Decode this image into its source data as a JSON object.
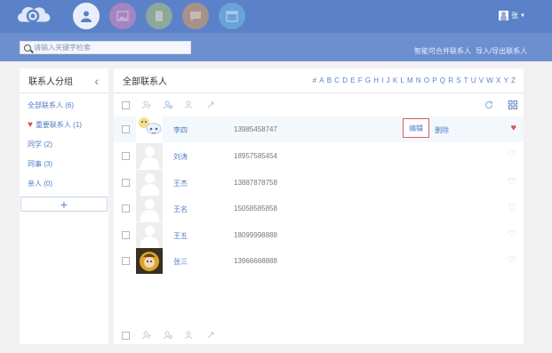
{
  "header": {
    "logo": "cloud-logo",
    "nav": [
      {
        "icon": "person-icon",
        "color": "#e9effa"
      },
      {
        "icon": "image-icon",
        "color": "#a385c2"
      },
      {
        "icon": "document-icon",
        "color": "#8da79a"
      },
      {
        "icon": "chat-icon",
        "color": "#a6928a"
      },
      {
        "icon": "calendar-icon",
        "color": "#6aa3d8"
      }
    ],
    "user_name": "张"
  },
  "search": {
    "placeholder": "请输入关键字检索"
  },
  "links": {
    "merge": "智能可合并联系人",
    "import_export": "导入/导出联系人"
  },
  "sidebar": {
    "title": "联系人分组",
    "groups": [
      {
        "label": "全部联系人 (6)"
      },
      {
        "label": "重要联系人 (1)",
        "icon": "heart-icon"
      },
      {
        "label": "同学 (2)"
      },
      {
        "label": "同事 (3)"
      },
      {
        "label": "亲人 (0)"
      }
    ],
    "add_label": "+"
  },
  "main": {
    "title": "全部联系人",
    "letters": [
      "#",
      "A",
      "B",
      "C",
      "D",
      "E",
      "F",
      "G",
      "H",
      "I",
      "J",
      "K",
      "L",
      "M",
      "N",
      "O",
      "P",
      "Q",
      "R",
      "S",
      "T",
      "U",
      "V",
      "W",
      "X",
      "Y",
      "Z"
    ],
    "contacts": [
      {
        "name": "李四",
        "phone": "13985458747",
        "favorite": true,
        "avatar": "cartoon-avatar"
      },
      {
        "name": "刘涛",
        "phone": "18957585454",
        "favorite": false,
        "avatar": "default-avatar"
      },
      {
        "name": "王杰",
        "phone": "13887878758",
        "favorite": false,
        "avatar": "default-avatar"
      },
      {
        "name": "王名",
        "phone": "15058585858",
        "favorite": false,
        "avatar": "default-avatar"
      },
      {
        "name": "王五",
        "phone": "18099998888",
        "favorite": false,
        "avatar": "default-avatar"
      },
      {
        "name": "张三",
        "phone": "13966668888",
        "favorite": false,
        "avatar": "photo-avatar"
      }
    ],
    "edit_label": "编辑",
    "delete_label": "删除"
  },
  "colors": {
    "topbar": "#5b82c9",
    "accent": "#4e7dc6",
    "favorite": "#e0525a"
  }
}
